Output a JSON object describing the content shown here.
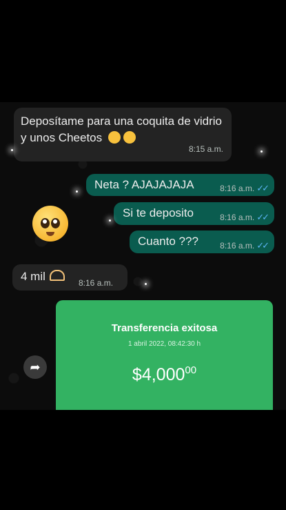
{
  "messages": [
    {
      "text": "Deposítame para una coquita de vidrio y unos Cheetos",
      "time": "8:15 a.m."
    },
    {
      "text": "Neta ? AJAJAJAJA",
      "time": "8:16 a.m."
    },
    {
      "text": "Si te deposito",
      "time": "8:16 a.m."
    },
    {
      "text": "Cuanto ???",
      "time": "8:16 a.m."
    },
    {
      "text": "4 mil",
      "time": "8:16 a.m."
    }
  ],
  "ticks": "✓✓",
  "transfer": {
    "title": "Transferencia exitosa",
    "date": "1 abril 2022, 08:42:30 h",
    "amount_main": "$4,000",
    "amount_cents": "00"
  },
  "icons": {
    "forward": "forward-arrow-icon",
    "sticker": "pleading-face-icon"
  },
  "colors": {
    "incoming_bubble": "#232323",
    "outgoing_bubble": "#0a5c4f",
    "transfer_card": "#33b262",
    "read_ticks": "#5cb5f5"
  }
}
